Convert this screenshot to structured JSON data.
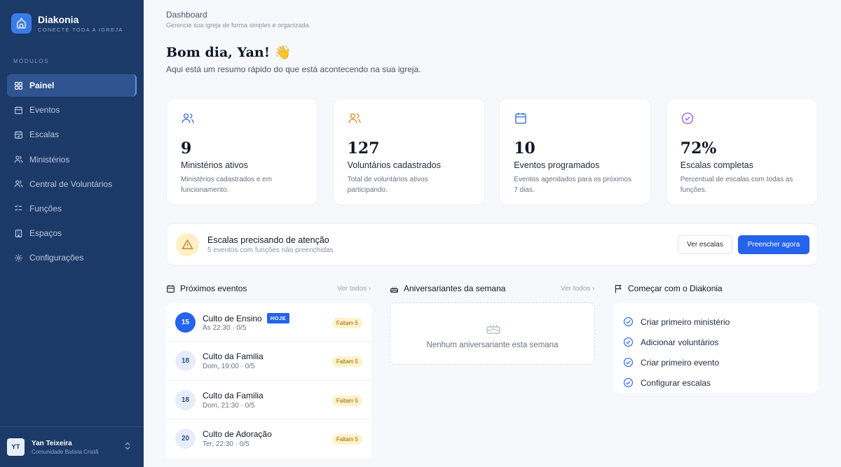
{
  "brand": {
    "name": "Diakonia",
    "tagline": "CONECTE TODA A IGREJA"
  },
  "sidebar": {
    "section_label": "MÓDULOS",
    "items": [
      {
        "label": "Painel",
        "icon": "grid-icon",
        "active": true
      },
      {
        "label": "Eventos",
        "icon": "calendar-icon"
      },
      {
        "label": "Escalas",
        "icon": "calendar-check-icon"
      },
      {
        "label": "Ministérios",
        "icon": "users-icon"
      },
      {
        "label": "Central de Voluntários",
        "icon": "users-icon"
      },
      {
        "label": "Funções",
        "icon": "list-check-icon"
      },
      {
        "label": "Espaços",
        "icon": "building-icon"
      },
      {
        "label": "Configurações",
        "icon": "gear-icon"
      }
    ]
  },
  "user": {
    "initials": "YT",
    "name": "Yan Teixeira",
    "church": "Comunidade Batista Cristã"
  },
  "header": {
    "title": "Dashboard",
    "subtitle": "Gerencie sua igreja de forma simples e organizada."
  },
  "greeting": {
    "title": "Bom dia, Yan! 👋",
    "subtitle": "Aqui está um resumo rápido do que está acontecendo na sua igreja."
  },
  "stats": [
    {
      "value": "9",
      "label": "Ministérios ativos",
      "desc": "Ministérios cadastrados e em funcionamento.",
      "color": "#3b6fd1"
    },
    {
      "value": "127",
      "label": "Voluntários cadastrados",
      "desc": "Total de voluntários ativos participando.",
      "color": "#e08a2c"
    },
    {
      "value": "10",
      "label": "Eventos programados",
      "desc": "Eventos agendados para os próximos 7 dias.",
      "color": "#3b6fd1"
    },
    {
      "value": "72%",
      "label": "Escalas completas",
      "desc": "Percentual de escalas com todas as funções.",
      "color": "#8b5cf6"
    }
  ],
  "alert": {
    "title": "Escalas precisando de atenção",
    "subtitle": "5 eventos com funções não preenchidas",
    "secondary_button": "Ver escalas",
    "primary_button": "Preencher agora"
  },
  "events_section": {
    "title": "Próximos eventos",
    "see_all": "Ver todos ›",
    "items": [
      {
        "day": "15",
        "title": "Culto de Ensino",
        "tag": "HOJE",
        "time": "Às 22:30",
        "count": "· 0/5",
        "missing": "Faltam 5"
      },
      {
        "day": "18",
        "title": "Culto da Familia",
        "time": "Dom, 19:00",
        "count": "· 0/5",
        "missing": "Faltam 5"
      },
      {
        "day": "18",
        "title": "Culto da Familia",
        "time": "Dom, 21:30",
        "count": "· 0/5",
        "missing": "Faltam 5"
      },
      {
        "day": "20",
        "title": "Culto de Adoração",
        "time": "Ter, 22:30",
        "count": "· 0/5",
        "missing": "Faltam 5"
      }
    ]
  },
  "birthdays_section": {
    "title": "Aniversariantes da semana",
    "see_all": "Ver todos ›",
    "empty_text": "Nenhum aniversariante esta semana"
  },
  "getting_started": {
    "title": "Começar com o Diakonia",
    "items": [
      {
        "label": "Criar primeiro ministério"
      },
      {
        "label": "Adicionar voluntários"
      },
      {
        "label": "Criar primeiro evento"
      },
      {
        "label": "Configurar escalas"
      }
    ]
  },
  "colors": {
    "sidebar": "#1c3a68",
    "accent": "#2563eb",
    "warning": "#fdf0c6"
  }
}
